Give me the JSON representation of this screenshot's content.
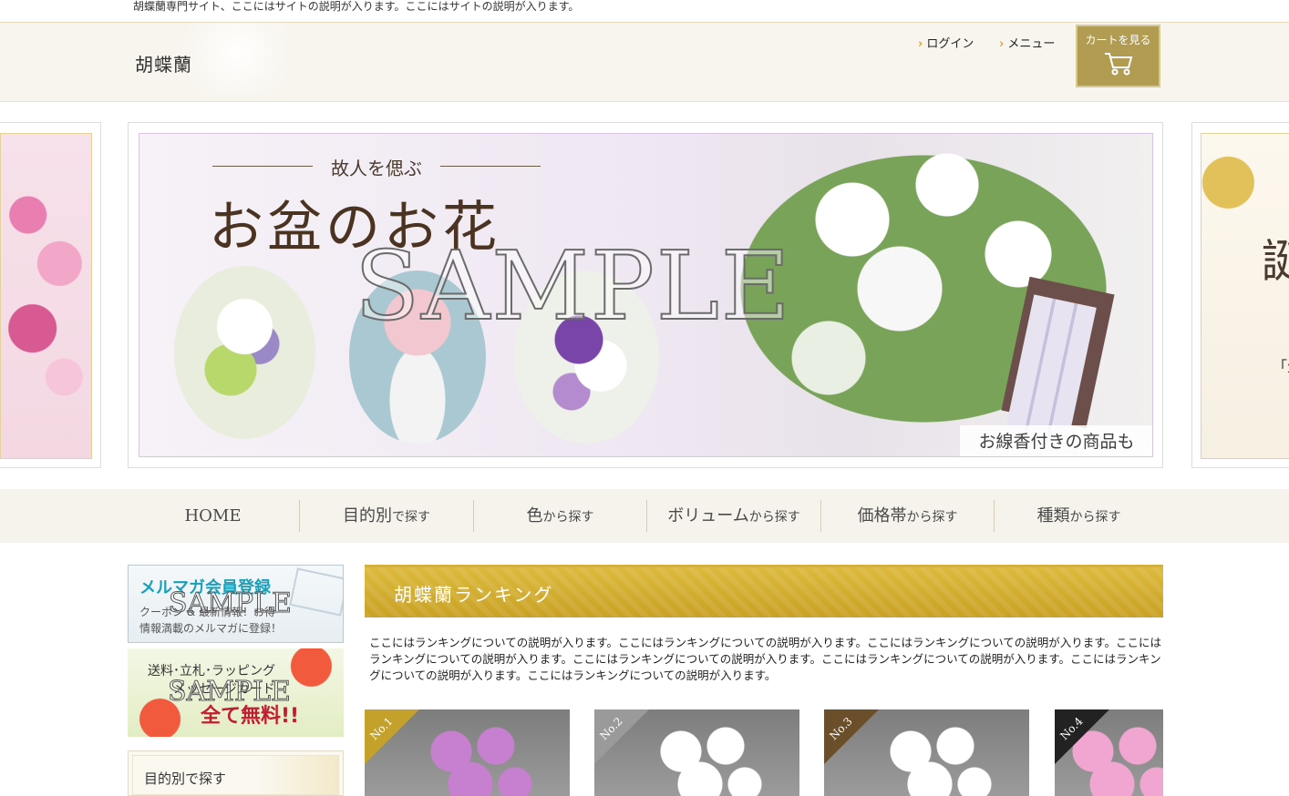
{
  "site": {
    "tagline": "胡蝶蘭専門サイト、ここにはサイトの説明が入ります。ここにはサイトの説明が入ります。",
    "logo": "胡蝶蘭"
  },
  "header": {
    "links": [
      {
        "label": "ログイン"
      },
      {
        "label": "メニュー"
      }
    ],
    "cart_label": "カートを見る"
  },
  "hero": {
    "subtitle": "故人を偲ぶ",
    "title": "お盆のお花",
    "caption": "お線香付きの商品も",
    "watermark": "SAMPLE",
    "right_glyph": "誕",
    "right_small": "「生"
  },
  "gnav": [
    {
      "big": "HOME",
      "small": ""
    },
    {
      "big": "目的別",
      "small": "で探す"
    },
    {
      "big": "色",
      "small": "から探す"
    },
    {
      "big": "ボリューム",
      "small": "から探す"
    },
    {
      "big": "価格帯",
      "small": "から探す"
    },
    {
      "big": "種類",
      "small": "から探す"
    }
  ],
  "sidebar": {
    "mail_banner": {
      "title": "メルマガ会員登録",
      "line1": "クーポン & 最新情報！お得",
      "line2": "情報満載のメルマガに登録！"
    },
    "free_banner": {
      "line1": "送料･立札･ラッピング",
      "line2": "メッセージカード",
      "line3": "全て無料!!"
    },
    "banner_watermark": "SAMPLE",
    "purpose_heading": "目的別で探す"
  },
  "ranking": {
    "heading": "胡蝶蘭ランキング",
    "description": "ここにはランキングについての説明が入ります。ここにはランキングについての説明が入ります。ここにはランキングについての説明が入ります。ここにはランキングについての説明が入ります。ここにはランキングについての説明が入ります。ここにはランキングについての説明が入ります。ここにはランキングについての説明が入ります。ここにはランキングについての説明が入ります。",
    "items": [
      {
        "badge": "No.1",
        "flower_color": "#c77fd0",
        "badge_color": "#c4a12a"
      },
      {
        "badge": "No.2",
        "flower_color": "#ffffff",
        "badge_color": "#9a9a9a"
      },
      {
        "badge": "No.3",
        "flower_color": "#ffffff",
        "badge_color": "#6b4e2a"
      },
      {
        "badge": "No.4",
        "flower_color": "#f0a6d0",
        "badge_color": "#222222"
      }
    ]
  }
}
